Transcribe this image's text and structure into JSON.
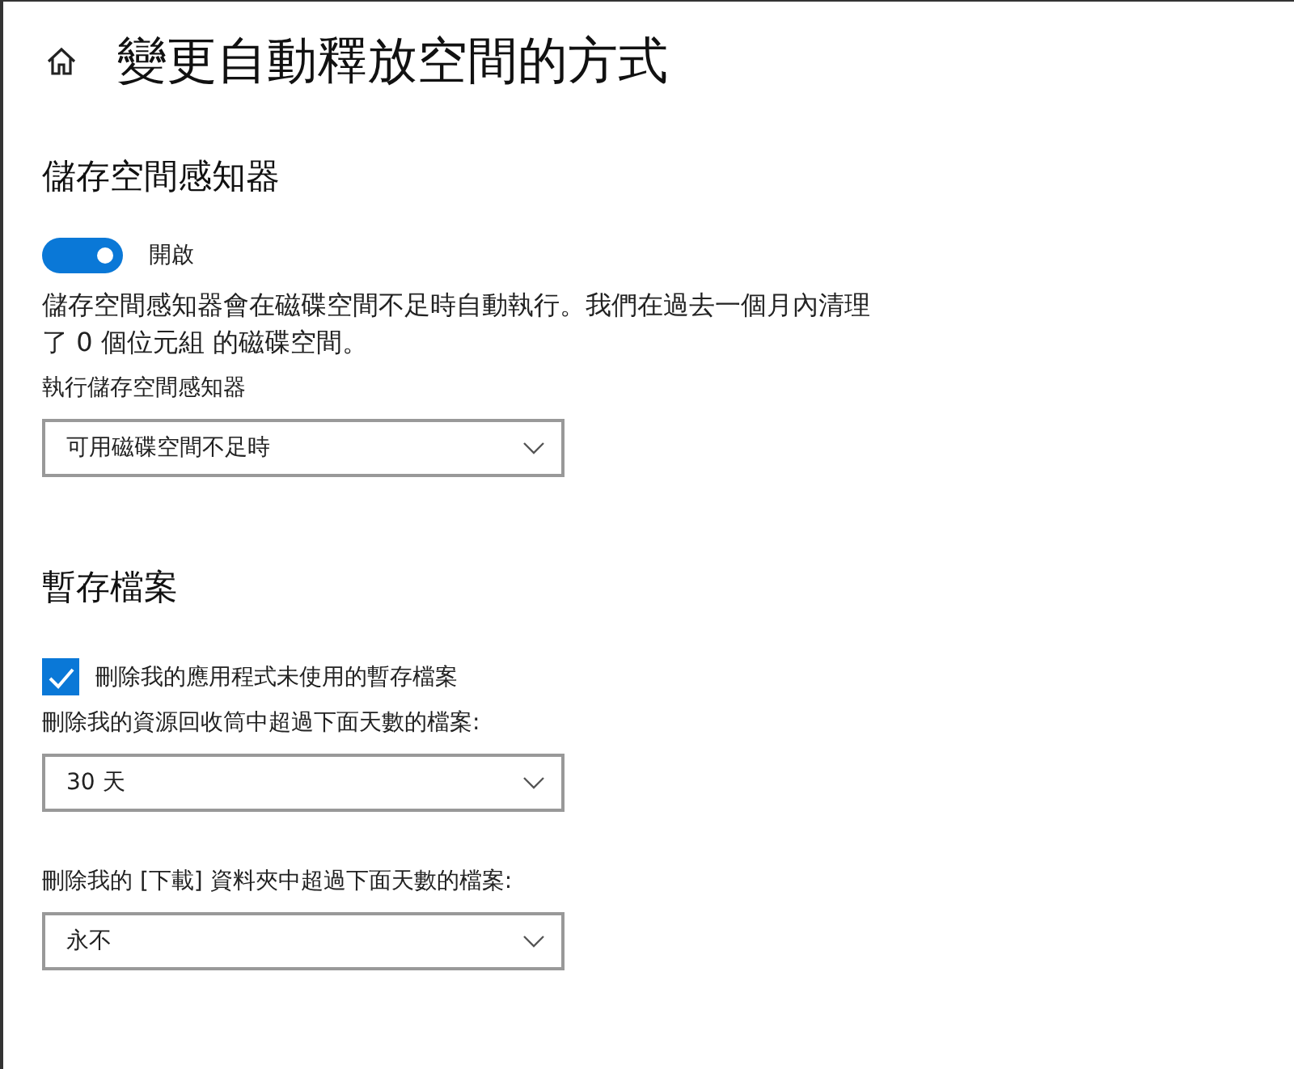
{
  "page": {
    "title": "變更自動釋放空間的方式"
  },
  "sections": [
    {
      "heading": "儲存空間感知器",
      "items": [
        {
          "kind": "toggle",
          "label": "開啟",
          "on": true
        },
        {
          "kind": "text",
          "text": "儲存空間感知器會在磁碟空間不足時自動執行。我們在過去一個月內清理了 0 個位元組 的磁碟空間。"
        },
        {
          "kind": "dropdown",
          "label": "執行儲存空間感知器",
          "value": "可用磁碟空間不足時"
        }
      ]
    },
    {
      "heading": "暫存檔案",
      "items": [
        {
          "kind": "checkbox",
          "label": "刪除我的應用程式未使用的暫存檔案",
          "checked": true
        },
        {
          "kind": "dropdown",
          "label": "刪除我的資源回收筒中超過下面天數的檔案:",
          "value": "30 天"
        },
        {
          "kind": "dropdown",
          "label": "刪除我的 [下載] 資料夾中超過下面天數的檔案:",
          "value": "永不",
          "gap": true
        }
      ]
    }
  ]
}
